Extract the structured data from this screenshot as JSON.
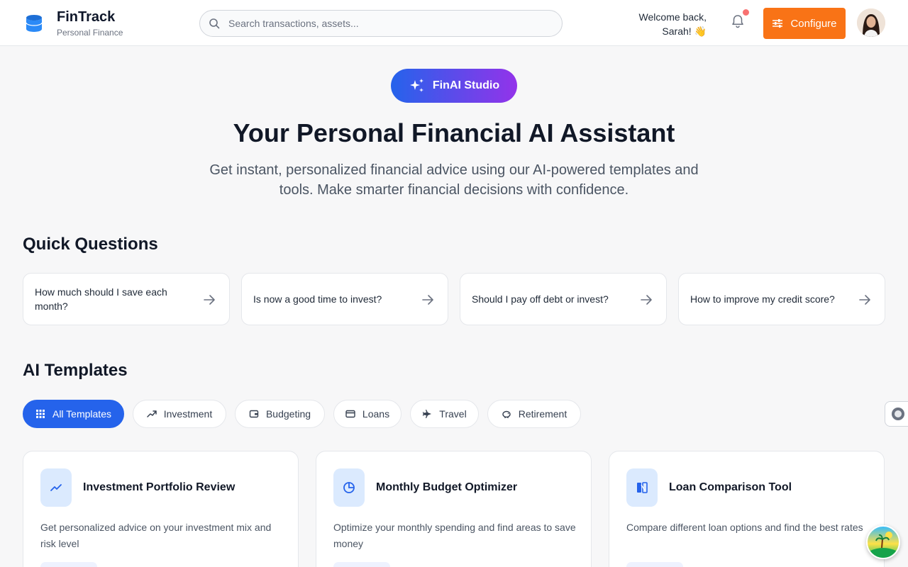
{
  "app": {
    "title": "FinTrack",
    "subtitle": "Personal Finance"
  },
  "search": {
    "placeholder": "Search transactions, assets..."
  },
  "welcome": {
    "line1": "Welcome back,",
    "line2": "Sarah! 👋"
  },
  "configure_label": "Configure",
  "colors": {
    "brand_blue": "#2563eb",
    "accent_orange": "#f97316",
    "gradient_end": "#9333ea"
  },
  "hero": {
    "badge": "FinAI Studio",
    "title": "Your Personal Financial AI Assistant",
    "subtitle": "Get instant, personalized financial advice using our AI-powered templates and tools. Make smarter financial decisions with confidence."
  },
  "quick_questions": {
    "title": "Quick Questions",
    "items": [
      "How much should I save each month?",
      "Is now a good time to invest?",
      "Should I pay off debt or invest?",
      "How to improve my credit score?"
    ]
  },
  "templates": {
    "title": "AI Templates",
    "filters": [
      {
        "label": "All Templates",
        "icon": "grid-icon",
        "active": true
      },
      {
        "label": "Investment",
        "icon": "trend-up-icon",
        "active": false
      },
      {
        "label": "Budgeting",
        "icon": "wallet-icon",
        "active": false
      },
      {
        "label": "Loans",
        "icon": "card-icon",
        "active": false
      },
      {
        "label": "Travel",
        "icon": "plane-icon",
        "active": false
      },
      {
        "label": "Retirement",
        "icon": "piggy-bank-icon",
        "active": false
      }
    ],
    "cards": [
      {
        "title": "Investment Portfolio Review",
        "desc": "Get personalized advice on your investment mix and risk level",
        "icon": "trend-up-icon"
      },
      {
        "title": "Monthly Budget Optimizer",
        "desc": "Optimize your monthly spending and find areas to save money",
        "icon": "pie-chart-icon"
      },
      {
        "title": "Loan Comparison Tool",
        "desc": "Compare different loan options and find the best rates",
        "icon": "compare-icon"
      }
    ]
  }
}
